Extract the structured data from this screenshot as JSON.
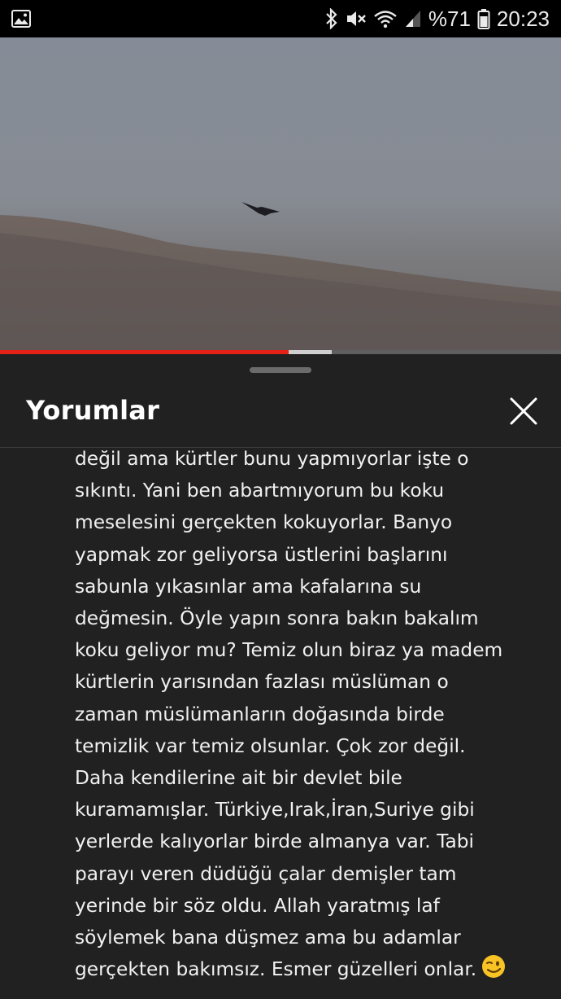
{
  "status_bar": {
    "left_icon": "gallery-notification-icon",
    "icons": [
      "bluetooth-icon",
      "mute-icon",
      "wifi-icon",
      "signal-icon"
    ],
    "battery": "%71",
    "time": "20:23"
  },
  "video": {
    "played_fraction": 0.515,
    "buffered_fraction": 0.592,
    "colors": {
      "played": "#e62117",
      "buffered": "#cfcfcf",
      "track": "#5f5f5f"
    }
  },
  "comments_panel": {
    "title": "Yorumlar",
    "close_icon": "close-icon",
    "comment_lines": [
      "değil ama kürtler bunu yapmıyorlar işte o",
      "sıkıntı. Yani ben abartmıyorum bu koku",
      "meselesini gerçekten kokuyorlar. Banyo",
      "yapmak zor geliyorsa üstlerini başlarını",
      "sabunla yıkasınlar ama kafalarına su",
      "değmesin. Öyle yapın sonra bakın bakalım",
      "koku geliyor mu? Temiz olun biraz ya madem",
      "kürtlerin yarısından fazlası müslüman o",
      "zaman müslümanların doğasında birde",
      "temizlik var temiz olsunlar. Çok zor değil.",
      "Daha kendilerine ait bir devlet bile",
      "kuramamışlar. Türkiye,Irak,İran,Suriye gibi",
      "yerlerde kalıyorlar birde almanya var. Tabi",
      "parayı veren düdüğü çalar demişler tam",
      "yerinde bir söz oldu. Allah yaratmış laf",
      "söylemek bana düşmez ama bu adamlar",
      "gerçekten bakımsız. Esmer güzelleri onlar."
    ],
    "trailing_emoji": "winking-face-emoji"
  }
}
